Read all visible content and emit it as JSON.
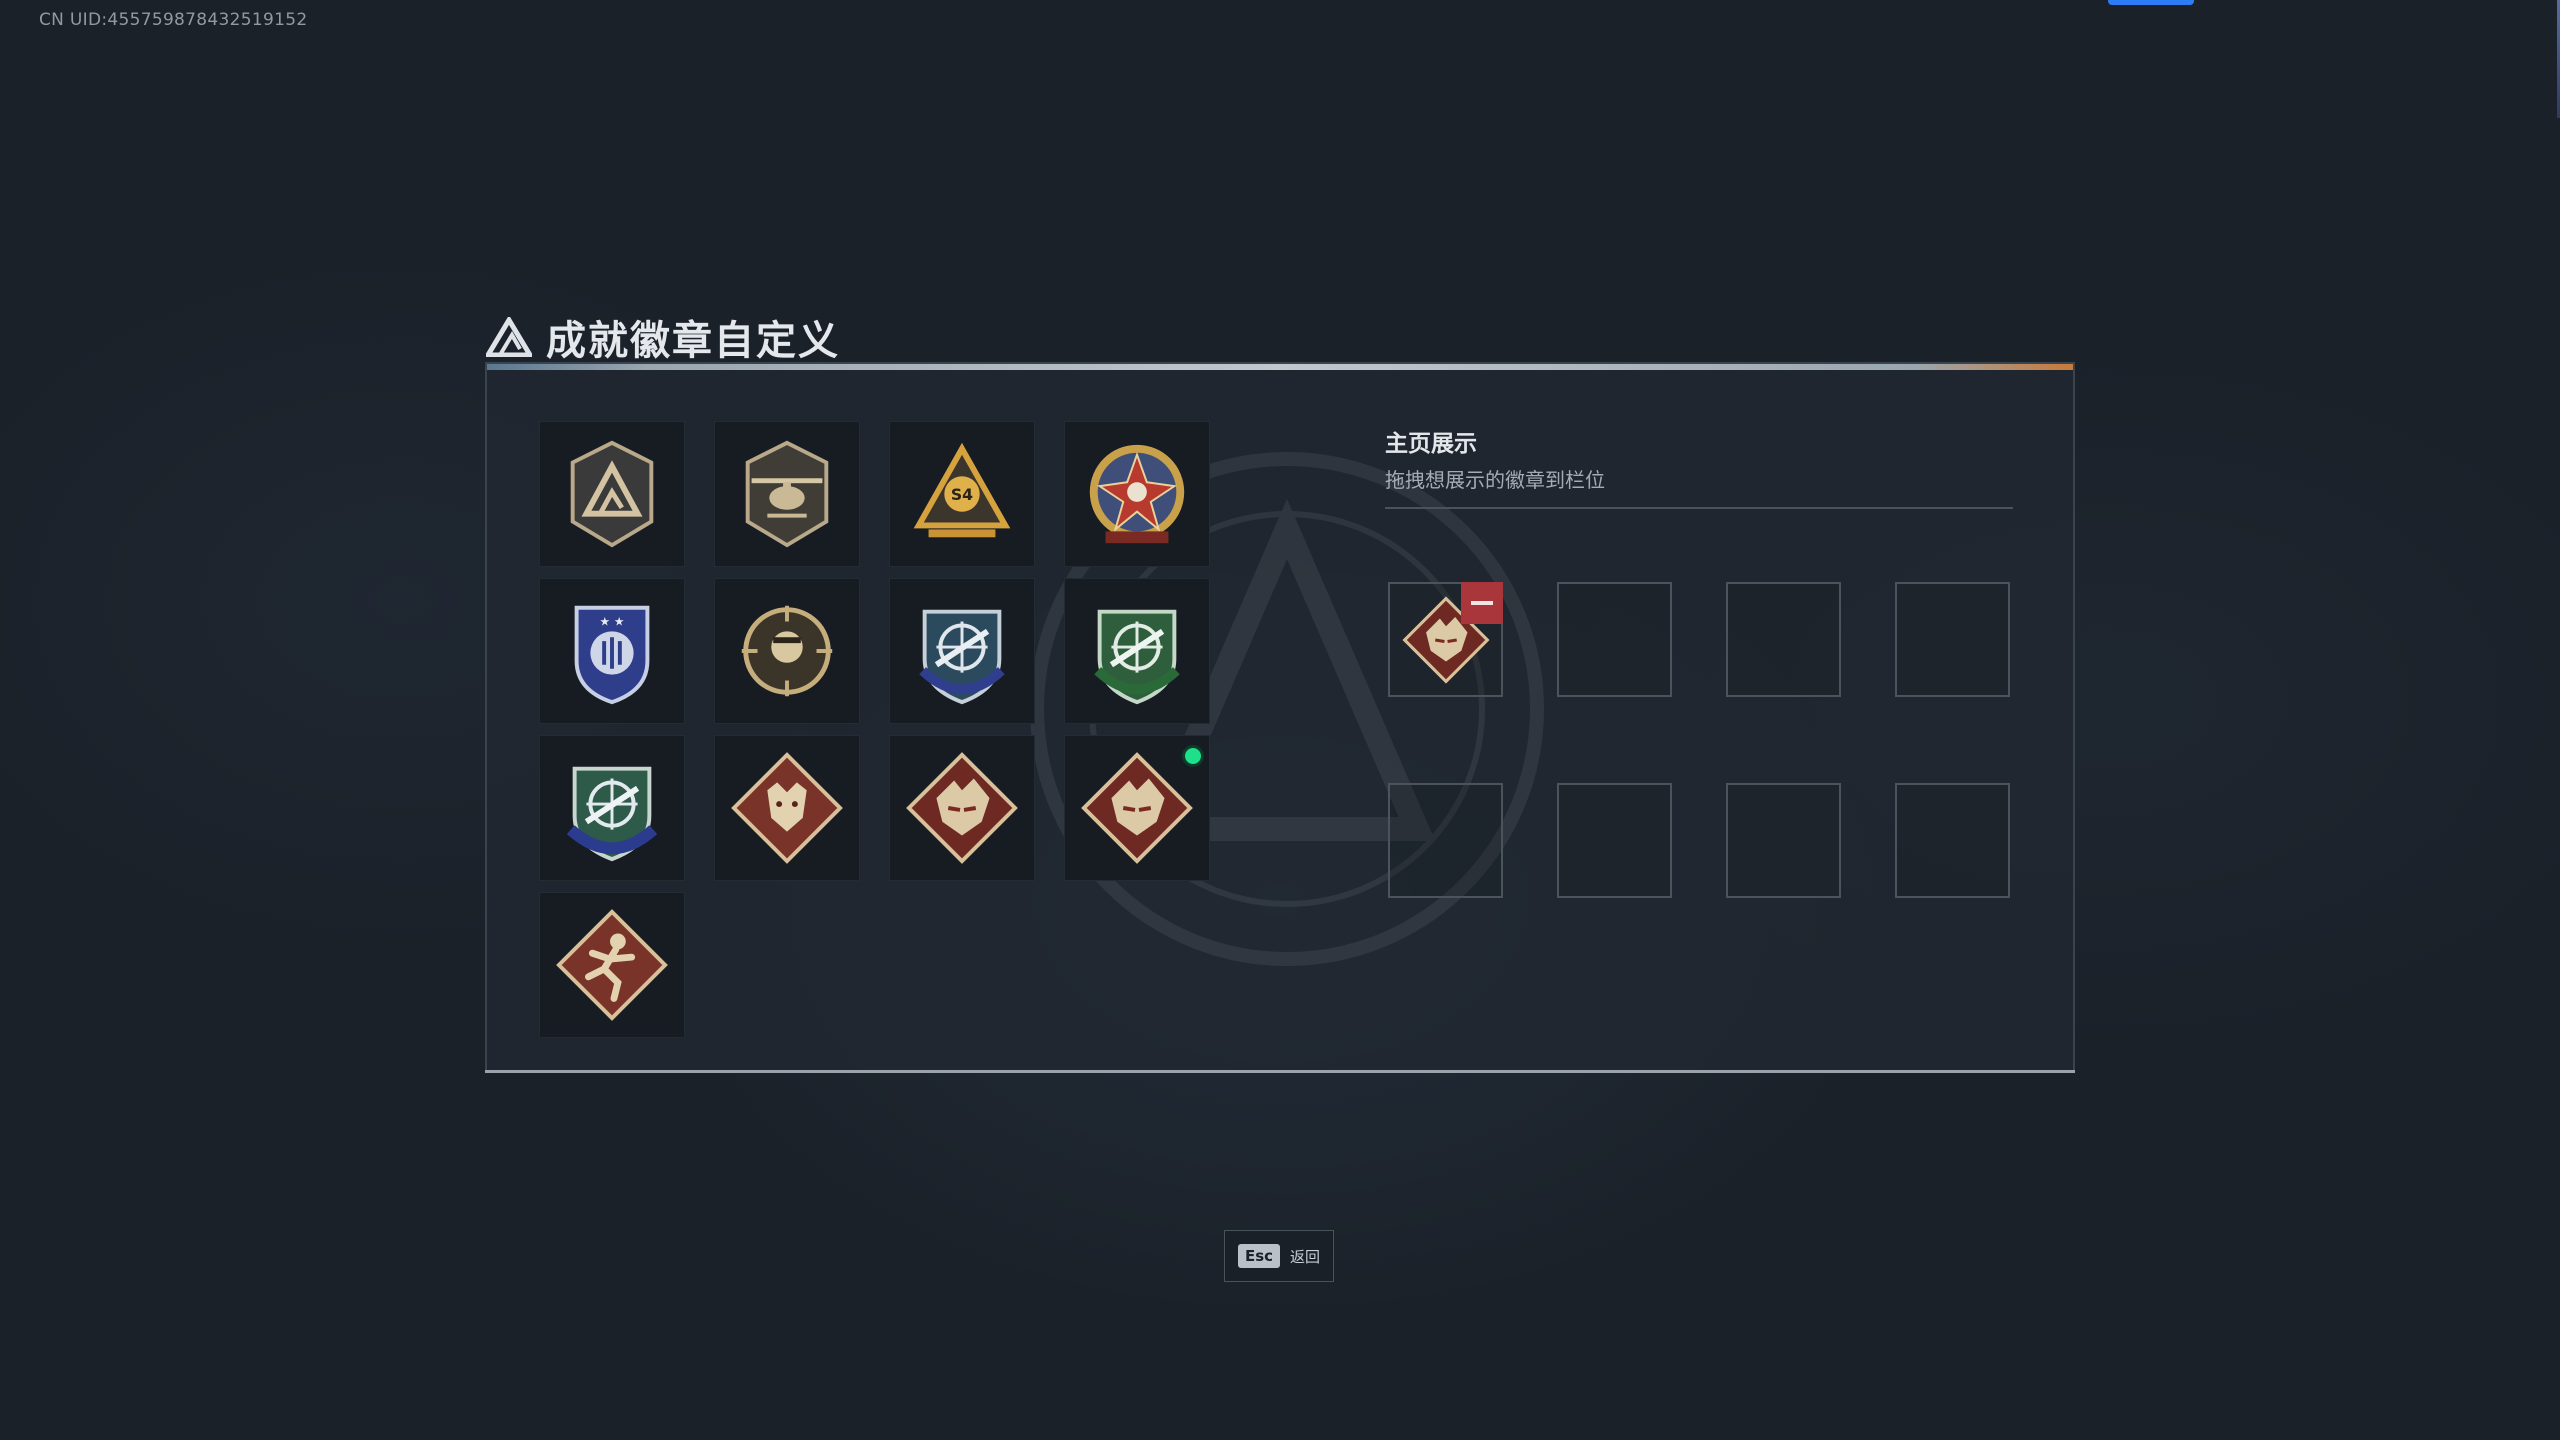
{
  "header": {
    "uid": "CN UID:455759878432519152"
  },
  "title": "成就徽章自定义",
  "badges": [
    {
      "name": "triangle-shield-badge-icon"
    },
    {
      "name": "helicopter-shield-badge-icon"
    },
    {
      "name": "s4-triangle-badge-icon",
      "label": "S4"
    },
    {
      "name": "star-skull-medal-badge-icon"
    },
    {
      "name": "blue-crest-badge-icon"
    },
    {
      "name": "skull-crosshair-badge-icon"
    },
    {
      "name": "blue-rifle-crosshair-badge-icon"
    },
    {
      "name": "green-rifle-crosshair-badge-icon"
    },
    {
      "name": "green-blue-rifle-badge-icon"
    },
    {
      "name": "wolf-diamond-badge-icon"
    },
    {
      "name": "dragon-diamond-badge-icon"
    },
    {
      "name": "dragon-diamond-new-badge-icon",
      "is_new": true
    },
    {
      "name": "ninja-runner-diamond-badge-icon"
    }
  ],
  "showcase": {
    "title": "主页展示",
    "subtitle": "拖拽想展示的徽章到栏位",
    "slots": [
      {
        "filled": true,
        "badge": "dragon-diamond-badge-icon"
      },
      {
        "filled": false
      },
      {
        "filled": false
      },
      {
        "filled": false
      },
      {
        "filled": false
      },
      {
        "filled": false
      },
      {
        "filled": false
      },
      {
        "filled": false
      }
    ]
  },
  "footer": {
    "esc_key": "Esc",
    "esc_label": "返回"
  },
  "colors": {
    "accent": "#2e7bf6",
    "remove": "#a8363a",
    "new_dot": "#1ee08a"
  }
}
